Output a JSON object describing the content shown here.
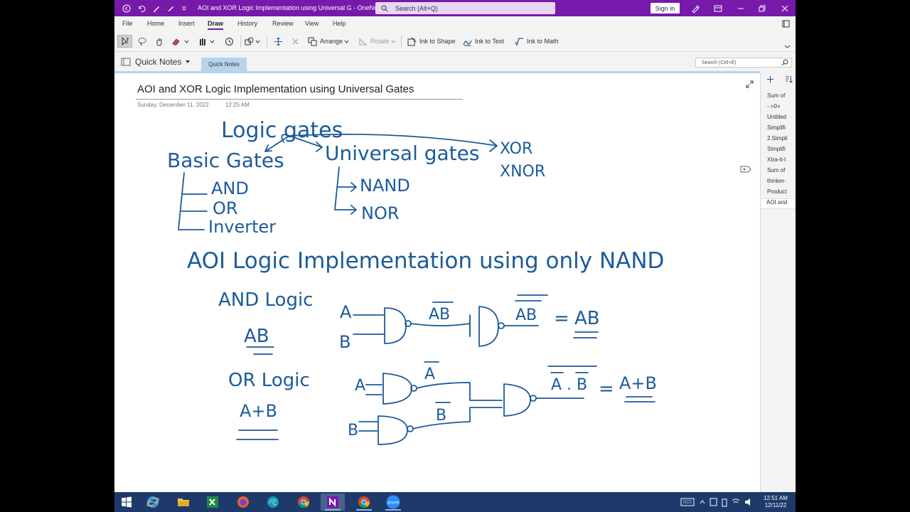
{
  "window": {
    "title": "AOI and XOR Logic Implementation using Universal G  -  OneNote",
    "search_placeholder": "Search (Alt+Q)",
    "signin_label": "Sign in"
  },
  "menu": {
    "tabs": [
      "File",
      "Home",
      "Insert",
      "Draw",
      "History",
      "Review",
      "View",
      "Help"
    ],
    "active": "Draw"
  },
  "ribbon": {
    "arrange_label": "Arrange",
    "rotate_label": "Rotate",
    "ink_to_shape_label": "Ink to Shape",
    "ink_to_text_label": "Ink to Text",
    "ink_to_math_label": "Ink to Math"
  },
  "notebook": {
    "name": "Quick Notes",
    "section_tab": "Quick Notes",
    "page_search_placeholder": "Search (Ctrl+E)"
  },
  "page": {
    "title": "AOI and XOR Logic Implementation using Universal Gates",
    "date": "Sunday, December 11, 2022",
    "time": "12:25 AM",
    "ink": {
      "logic_gates": "Logic gates",
      "basic_gates": "Basic Gates",
      "universal_gates": "Universal gates",
      "xor": "XOR",
      "xnor": "XNOR",
      "and": "AND",
      "or": "OR",
      "inverter": "Inverter",
      "nand": "NAND",
      "nor": "NOR",
      "aoi_heading": "AOI Logic Implementation using only NAND",
      "and_logic": "AND Logic",
      "ab": "AB",
      "a_in": "A",
      "b_in": "B",
      "ab_bar": "AB",
      "ab_dbar": "AB",
      "equals": "=",
      "ab_result": "AB",
      "or_logic": "OR Logic",
      "a_plus_b": "A+B",
      "a_in2": "A",
      "b_in2": "B",
      "a_bar": "A",
      "b_bar": "B",
      "a_dot_b": "A . B",
      "equals2": "=",
      "or_result": "A+B"
    }
  },
  "pages_pane": {
    "items": [
      "Sum of",
      "-    =0+",
      "Untitled",
      "Simplifi",
      "2.Simpli",
      "Simplifi",
      "Xtra-it-I",
      "Sum of",
      "thinker-",
      "Product",
      "AOI and"
    ],
    "current_index": 10
  },
  "taskbar": {
    "time": "12:51 AM",
    "date": "12/11/22",
    "zoom_label": "zoom"
  },
  "colors": {
    "onenote_purple": "#7719aa",
    "ink_blue": "#1c5b9a",
    "section_tab": "#b6d4ec",
    "taskbar": "#1e3a6a"
  }
}
